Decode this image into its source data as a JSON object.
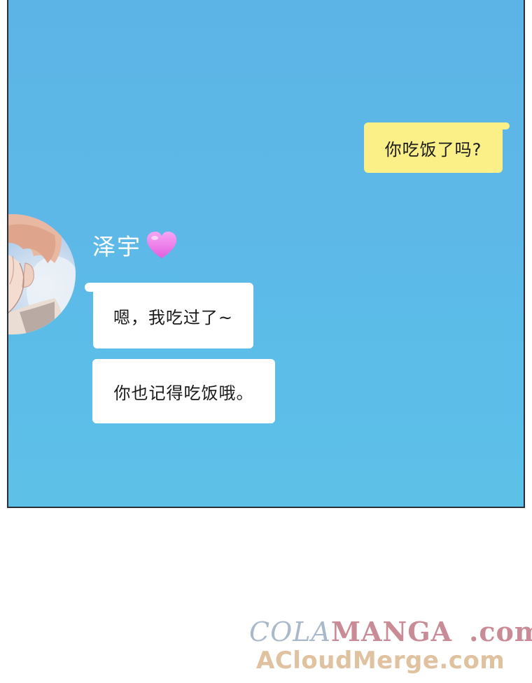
{
  "chat": {
    "outgoing": [
      {
        "text": "你吃饭了吗?"
      }
    ],
    "contact": {
      "name": "泽宇",
      "name_emoji": "heart-icon"
    },
    "incoming": [
      {
        "text": "嗯，我吃过了~"
      },
      {
        "text": "你也记得吃饭哦。"
      }
    ]
  },
  "watermark": {
    "part1": "COLA",
    "part2": "MANGA",
    "part3": ".com",
    "line2": "ACloudMerge.com"
  },
  "colors": {
    "chat_background": "#5db8e7",
    "outgoing_bubble": "#fbf087",
    "incoming_bubble": "#ffffff",
    "heart": "#e86ee8"
  }
}
